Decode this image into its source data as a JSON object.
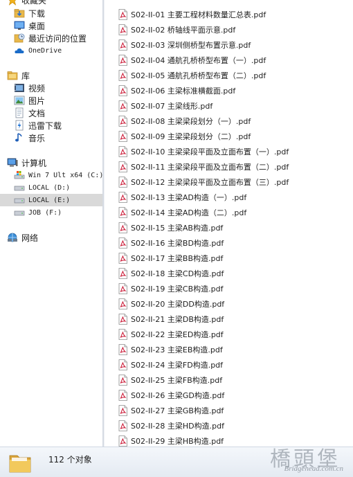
{
  "nav": {
    "favorites": {
      "header": "收藏夹",
      "items": [
        {
          "label": "下载",
          "icon": "download-folder-icon"
        },
        {
          "label": "桌面",
          "icon": "desktop-icon"
        },
        {
          "label": "最近访问的位置",
          "icon": "recent-places-icon"
        },
        {
          "label": "OneDrive",
          "icon": "onedrive-icon"
        }
      ]
    },
    "libraries": {
      "header": "库",
      "items": [
        {
          "label": "视频",
          "icon": "videos-icon"
        },
        {
          "label": "图片",
          "icon": "pictures-icon"
        },
        {
          "label": "文档",
          "icon": "documents-icon"
        },
        {
          "label": "迅雷下载",
          "icon": "thunder-download-icon"
        },
        {
          "label": "音乐",
          "icon": "music-icon"
        }
      ]
    },
    "computer": {
      "header": "计算机",
      "items": [
        {
          "label": "Win 7 Ult x64 (C:)",
          "icon": "system-drive-icon"
        },
        {
          "label": "LOCAL (D:)",
          "icon": "drive-icon"
        },
        {
          "label": "LOCAL (E:)",
          "icon": "drive-icon",
          "selected": true
        },
        {
          "label": "JOB (F:)",
          "icon": "drive-icon"
        }
      ]
    },
    "network": {
      "label": "网络",
      "icon": "network-icon"
    }
  },
  "files": [
    "S02-II-01 主要工程材料数量汇总表.pdf",
    "S02-II-02 桥轴线平面示意.pdf",
    "S02-II-03 深圳侧桥型布置示意.pdf",
    "S02-II-04 通航孔桥桥型布置（一）.pdf",
    "S02-II-05 通航孔桥桥型布置（二）.pdf",
    "S02-II-06 主梁标准横截面.pdf",
    "S02-II-07 主梁线形.pdf",
    "S02-II-08 主梁梁段划分（一）.pdf",
    "S02-II-09 主梁梁段划分（二）.pdf",
    "S02-II-10 主梁梁段平面及立面布置（一）.pdf",
    "S02-II-11 主梁梁段平面及立面布置（二）.pdf",
    "S02-II-12 主梁梁段平面及立面布置（三）.pdf",
    "S02-II-13 主梁AD构造（一）.pdf",
    "S02-II-14 主梁AD构造（二）.pdf",
    "S02-II-15 主梁AB构造.pdf",
    "S02-II-16 主梁BD构造.pdf",
    "S02-II-17 主梁BB构造.pdf",
    "S02-II-18 主梁CD构造.pdf",
    "S02-II-19 主梁CB构造.pdf",
    "S02-II-20 主梁DD构造.pdf",
    "S02-II-21 主梁DB构造.pdf",
    "S02-II-22 主梁ED构造.pdf",
    "S02-II-23 主梁EB构造.pdf",
    "S02-II-24 主梁FD构造.pdf",
    "S02-II-25 主梁FB构造.pdf",
    "S02-II-26 主梁GD构造.pdf",
    "S02-II-27 主梁GB构造.pdf",
    "S02-II-28 主梁HD构造.pdf",
    "S02-II-29 主梁HB构造.pdf"
  ],
  "status": {
    "count_text": "112 个对象",
    "folder_icon": "folder-icon"
  },
  "watermark": {
    "cn": "橋頭堡",
    "en": "Bridgehead.com.cn"
  },
  "colors": {
    "selected_bg": "#d9d9d9",
    "pdf_red": "#c8102e",
    "folder_yellow": "#e8b84a"
  }
}
